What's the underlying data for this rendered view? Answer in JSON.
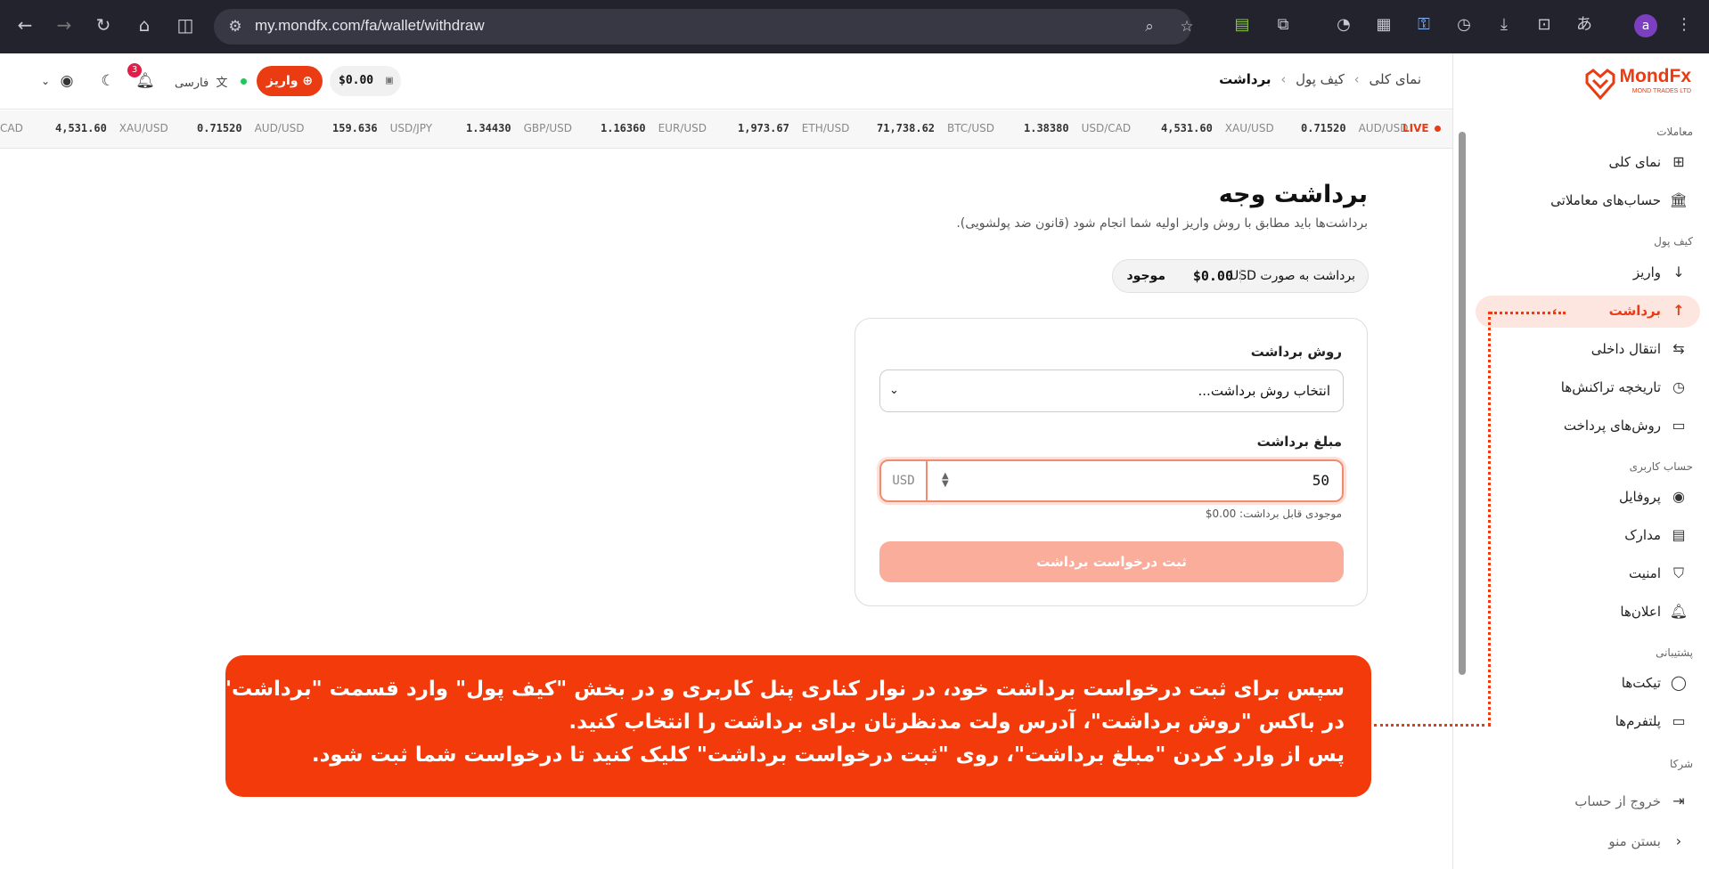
{
  "browser": {
    "url": "my.mondfx.com/fa/wallet/withdraw",
    "profile_initial": "a"
  },
  "header": {
    "breadcrumbs": [
      "نمای کلی",
      "کیف پول",
      "برداشت"
    ],
    "balance": "$0.00",
    "deposit_label": "واریز",
    "language": "فارسی",
    "notification_count": "3"
  },
  "ticker": {
    "live_label": "LIVE",
    "items": [
      {
        "symbol": "AUD/USD",
        "price": "0.71520"
      },
      {
        "symbol": "XAU/USD",
        "price": "4,531.60"
      },
      {
        "symbol": "USD/CAD",
        "price": "1.38380"
      },
      {
        "symbol": "BTC/USD",
        "price": "71,738.62"
      },
      {
        "symbol": "ETH/USD",
        "price": "1,973.67"
      },
      {
        "symbol": "EUR/USD",
        "price": "1.16360"
      },
      {
        "symbol": "GBP/USD",
        "price": "1.34430"
      },
      {
        "symbol": "USD/JPY",
        "price": "159.636"
      },
      {
        "symbol": "AUD/USD",
        "price": "0.71520"
      },
      {
        "symbol": "XAU/USD",
        "price": "4,531.60"
      },
      {
        "symbol": "CAD",
        "price": ""
      }
    ]
  },
  "sidebar": {
    "logo_text": "MondFx",
    "logo_sub": "MOND TRADES LTD",
    "sections": {
      "trading": "معاملات",
      "wallet": "کیف پول",
      "account": "حساب کاربری",
      "support": "پشتیبانی",
      "partners": "شرکا"
    },
    "items": {
      "overview": "نمای کلی",
      "trading_accounts": "حساب‌های معاملاتی",
      "deposit": "واریز",
      "withdraw": "برداشت",
      "internal_transfer": "انتقال داخلی",
      "history": "تاریخچه تراکنش‌ها",
      "payment_methods": "روش‌های پرداخت",
      "profile": "پروفایل",
      "documents": "مدارک",
      "security": "امنیت",
      "notifications": "اعلان‌ها",
      "tickets": "تیکت‌ها",
      "platforms": "پلتفرم‌ها",
      "logout": "خروج از حساب",
      "close_menu": "بستن منو"
    }
  },
  "main": {
    "title": "برداشت وجه",
    "subtitle": "برداشت‌ها باید مطابق با روش واریز اولیه شما انجام شود (قانون ضد پولشویی).",
    "available_pill": {
      "label": "برداشت به صورت USD",
      "amount": "$0.00",
      "suffix": "موجود"
    },
    "form": {
      "method_label": "روش برداشت",
      "method_placeholder": "انتخاب روش برداشت...",
      "amount_label": "مبلغ برداشت",
      "amount_value": "50",
      "currency": "USD",
      "hint": "موجودی قابل برداشت: 0.00$",
      "submit_label": "ثبت درخواست برداشت"
    }
  },
  "callout": {
    "line1": "سپس برای ثبت درخواست برداشت خود، در نوار کناری پنل کاربری و در بخش \"کیف پول\" وارد قسمت \"برداشت\" شوید.",
    "line2": "در باکس \"روش برداشت\"، آدرس ولت مدنظرتان برای برداشت را انتخاب کنید.",
    "line3": "پس از وارد کردن \"مبلغ برداشت\"، روی \"ثبت درخواست برداشت\" کلیک کنید تا درخواست شما ثبت شود."
  },
  "colors": {
    "accent": "#ea3b12",
    "callout_bg": "#f23a0a",
    "browser_bg": "#23232e"
  }
}
